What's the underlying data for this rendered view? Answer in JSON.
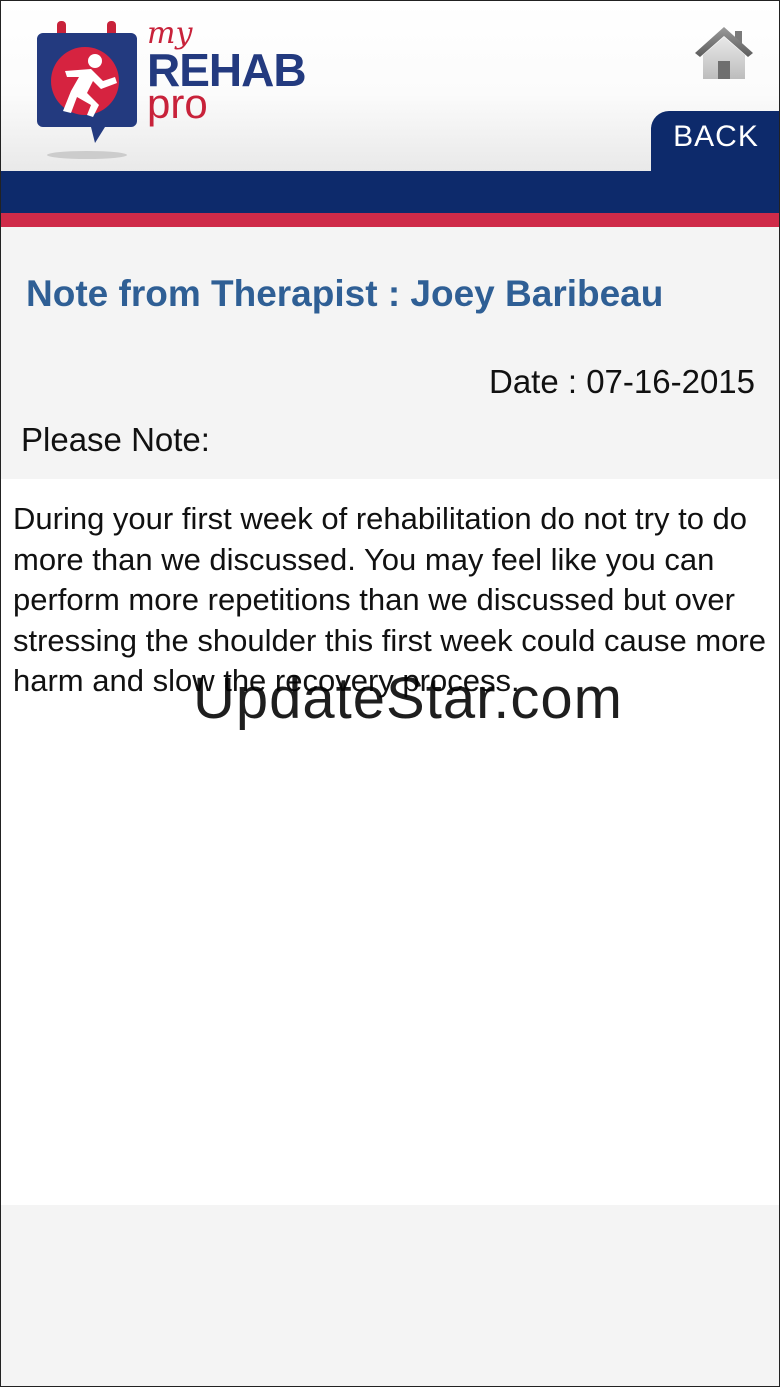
{
  "header": {
    "logo": {
      "my": "my",
      "rehab": "REHAB",
      "pro": "pro"
    },
    "home_icon": "home-icon",
    "back_label": "BACK"
  },
  "note": {
    "title": "Note from Therapist : Joey Baribeau",
    "date": "Date : 07-16-2015",
    "please_note": "Please Note:",
    "message": "During your first week of rehabilitation do not try to do more than we discussed. You may feel like you can perform more repetitions than we discussed but over stressing the shoulder this first week could cause more harm and slow the recovery process."
  },
  "watermark": "UpdateStar.com",
  "colors": {
    "navy": "#0d2a6b",
    "red": "#cf2b49",
    "title_blue": "#2f5f95"
  }
}
